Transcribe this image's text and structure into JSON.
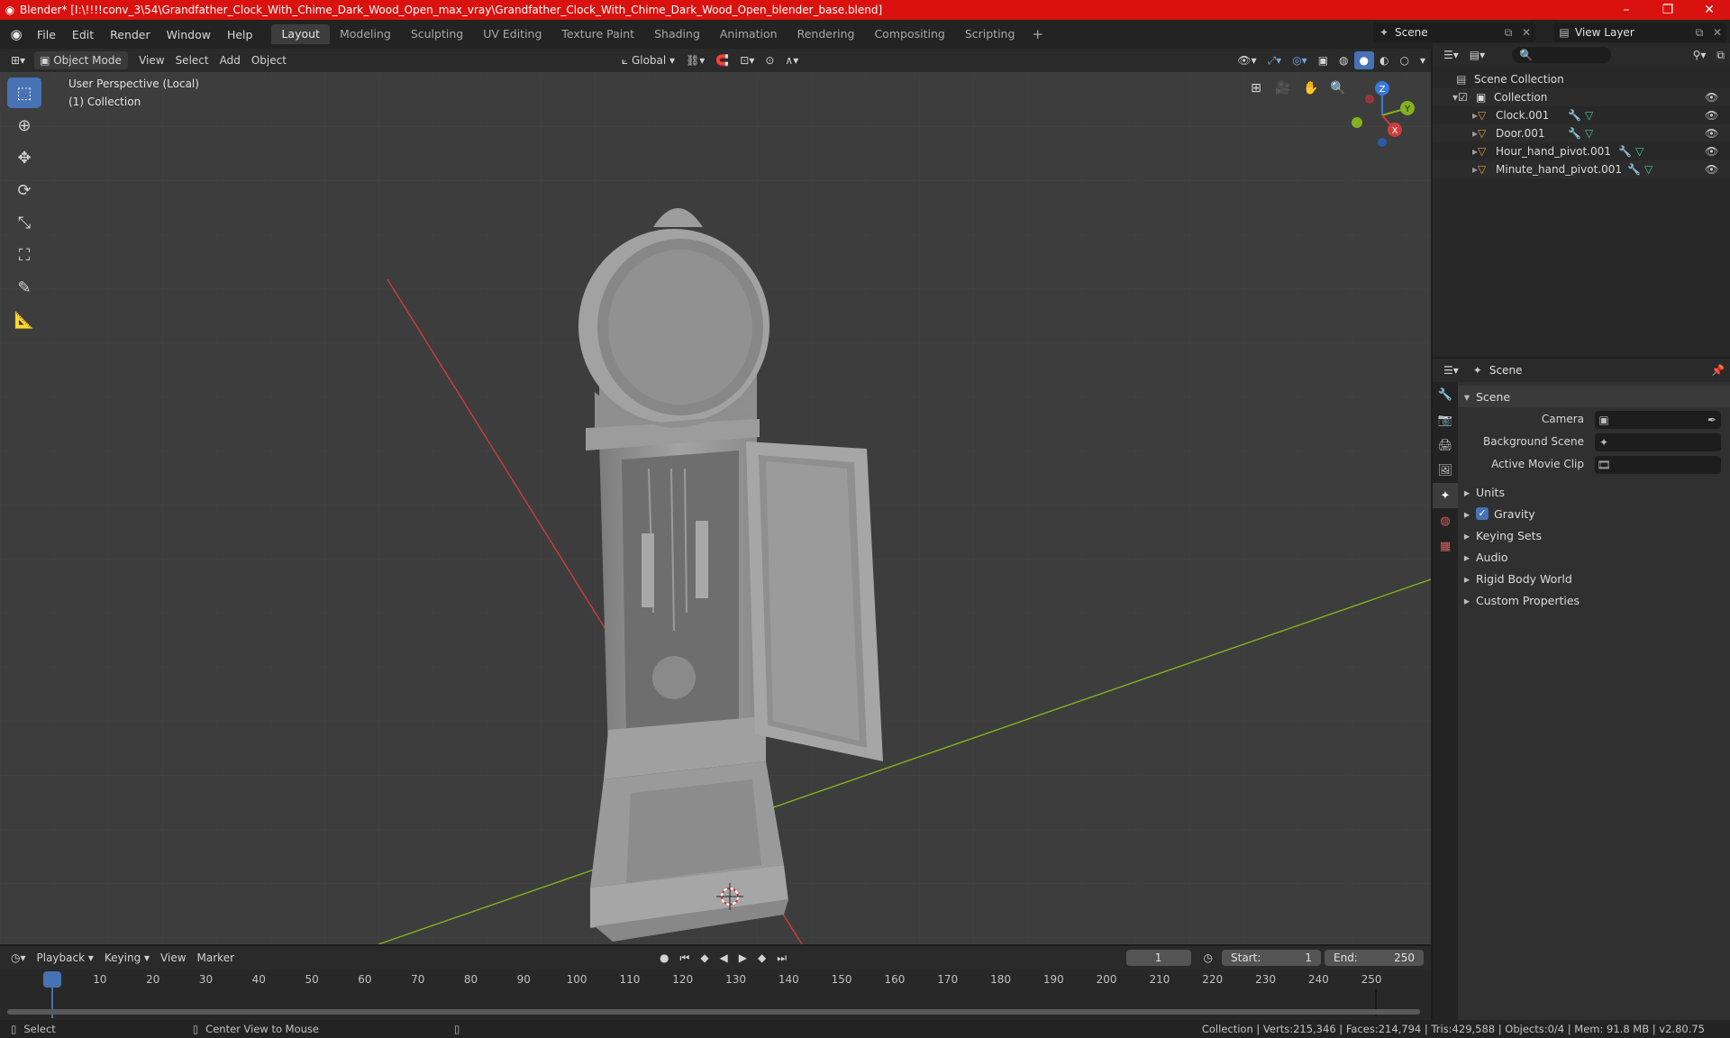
{
  "window": {
    "title": "Blender* [I:\\!!!!conv_3\\54\\Grandfather_Clock_With_Chime_Dark_Wood_Open_max_vray\\Grandfather_Clock_With_Chime_Dark_Wood_Open_blender_base.blend]",
    "minimize": "–",
    "maximize": "❐",
    "close": "✕"
  },
  "menubar": {
    "items": [
      "File",
      "Edit",
      "Render",
      "Window",
      "Help"
    ],
    "workspaces": [
      "Layout",
      "Modeling",
      "Sculpting",
      "UV Editing",
      "Texture Paint",
      "Shading",
      "Animation",
      "Rendering",
      "Compositing",
      "Scripting"
    ],
    "active_workspace": "Layout",
    "add_tab": "+",
    "scene": "Scene",
    "view_layer": "View Layer"
  },
  "viewport_header": {
    "mode": "Object Mode",
    "menus": [
      "View",
      "Select",
      "Add",
      "Object"
    ],
    "orientation": "Global"
  },
  "viewport": {
    "perspective_label": "User Perspective (Local)",
    "collection_label": "(1) Collection",
    "gizmo": {
      "x": "X",
      "y": "Y",
      "z": "Z"
    }
  },
  "outliner": {
    "root": "Scene Collection",
    "collection": "Collection",
    "objects": [
      "Clock.001",
      "Door.001",
      "Hour_hand_pivot.001",
      "Minute_hand_pivot.001"
    ]
  },
  "properties": {
    "header_context": "Scene",
    "panel_title": "Scene",
    "fields": [
      {
        "label": "Camera",
        "value": ""
      },
      {
        "label": "Background Scene",
        "value": ""
      },
      {
        "label": "Active Movie Clip",
        "value": ""
      }
    ],
    "subpanels": [
      "Units",
      "Gravity",
      "Keying Sets",
      "Audio",
      "Rigid Body World",
      "Custom Properties"
    ],
    "gravity_checked": true
  },
  "timeline": {
    "menus": [
      "Playback",
      "Keying",
      "View",
      "Marker"
    ],
    "current_frame": "1",
    "start_label": "Start:",
    "start": "1",
    "end_label": "End:",
    "end": "250",
    "ticks": [
      "1",
      "10",
      "20",
      "30",
      "40",
      "50",
      "60",
      "70",
      "80",
      "90",
      "100",
      "110",
      "120",
      "130",
      "140",
      "150",
      "160",
      "170",
      "180",
      "190",
      "200",
      "210",
      "220",
      "230",
      "240",
      "250"
    ]
  },
  "statusbar": {
    "left_action": "Select",
    "mid_action": "Center View to Mouse",
    "stats": "Collection | Verts:215,346 | Faces:214,794 | Tris:429,588 | Objects:0/4 | Mem: 91.8 MB | v2.80.75"
  },
  "colors": {
    "titlebar": "#d9120f",
    "accent": "#4772b3",
    "x_axis": "#cf3c3c",
    "y_axis": "#84b11e",
    "z_axis": "#3b78d8",
    "mesh_icon": "#e39b3c",
    "modifier_icon": "#6fa8dc",
    "data_icon": "#44c5a5"
  }
}
